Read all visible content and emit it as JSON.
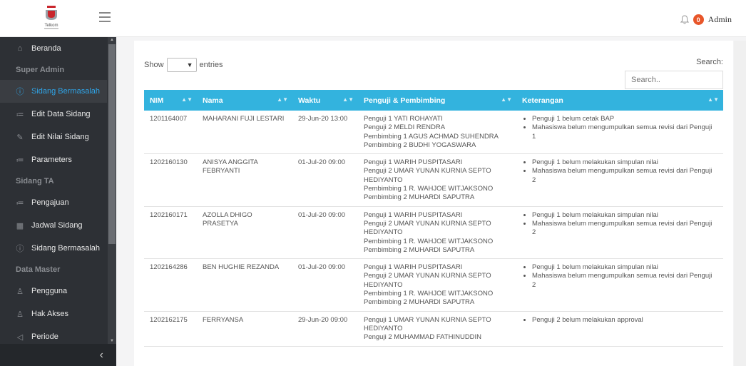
{
  "brand": {
    "logo_text": "Telkom"
  },
  "topbar": {
    "notif_count": "0",
    "user_name": "Admin",
    "bell_icon": "bell-icon"
  },
  "sidebar": {
    "items": [
      {
        "type": "item",
        "icon": "home-icon",
        "label": "Beranda"
      },
      {
        "type": "header",
        "label": "Super Admin"
      },
      {
        "type": "item",
        "icon": "alert-icon",
        "label": "Sidang Bermasalah",
        "active": true
      },
      {
        "type": "item",
        "icon": "list-icon",
        "label": "Edit Data Sidang"
      },
      {
        "type": "item",
        "icon": "pencil-icon",
        "label": "Edit Nilai Sidang"
      },
      {
        "type": "item",
        "icon": "list-icon",
        "label": "Parameters"
      },
      {
        "type": "header",
        "label": "Sidang TA"
      },
      {
        "type": "item",
        "icon": "list-icon",
        "label": "Pengajuan"
      },
      {
        "type": "item",
        "icon": "calendar-icon",
        "label": "Jadwal Sidang"
      },
      {
        "type": "item",
        "icon": "alert-icon",
        "label": "Sidang Bermasalah"
      },
      {
        "type": "header",
        "label": "Data Master"
      },
      {
        "type": "item",
        "icon": "user-icon",
        "label": "Pengguna"
      },
      {
        "type": "item",
        "icon": "user-icon",
        "label": "Hak Akses"
      },
      {
        "type": "item",
        "icon": "send-icon",
        "label": "Periode"
      }
    ],
    "collapse_glyph": "‹"
  },
  "table_controls": {
    "show_label": "Show",
    "entries_label": "entries",
    "search_label": "Search:",
    "search_placeholder": "Search.."
  },
  "table": {
    "columns": [
      "NIM",
      "Nama",
      "Waktu",
      "Penguji & Pembimbing",
      "Keterangan"
    ],
    "rows": [
      {
        "nim": "1201164007",
        "nama": "MAHARANI FUJI LESTARI",
        "waktu": "29-Jun-20 13:00",
        "penguji": [
          "Penguji 1 YATI ROHAYATI",
          "Penguji 2 MELDI RENDRA",
          "Pembimbing 1 AGUS ACHMAD SUHENDRA",
          "Pembimbing 2 BUDHI YOGASWARA"
        ],
        "keterangan": [
          "Penguji 1 belum cetak BAP",
          "Mahasiswa belum mengumpulkan semua revisi dari Penguji 1"
        ]
      },
      {
        "nim": "1202160130",
        "nama": "ANISYA ANGGITA FEBRYANTI",
        "waktu": "01-Jul-20 09:00",
        "penguji": [
          "Penguji 1 WARIH PUSPITASARI",
          "Penguji 2 UMAR YUNAN KURNIA SEPTO HEDIYANTO",
          "Pembimbing 1 R. WAHJOE WITJAKSONO",
          "Pembimbing 2 MUHARDI SAPUTRA"
        ],
        "keterangan": [
          "Penguji 1 belum melakukan simpulan nilai",
          "Mahasiswa belum mengumpulkan semua revisi dari Penguji 2"
        ]
      },
      {
        "nim": "1202160171",
        "nama": "AZOLLA DHIGO PRASETYA",
        "waktu": "01-Jul-20 09:00",
        "penguji": [
          "Penguji 1 WARIH PUSPITASARI",
          "Penguji 2 UMAR YUNAN KURNIA SEPTO HEDIYANTO",
          "Pembimbing 1 R. WAHJOE WITJAKSONO",
          "Pembimbing 2 MUHARDI SAPUTRA"
        ],
        "keterangan": [
          "Penguji 1 belum melakukan simpulan nilai",
          "Mahasiswa belum mengumpulkan semua revisi dari Penguji 2"
        ]
      },
      {
        "nim": "1202164286",
        "nama": "BEN HUGHIE REZANDA",
        "waktu": "01-Jul-20 09:00",
        "penguji": [
          "Penguji 1 WARIH PUSPITASARI",
          "Penguji 2 UMAR YUNAN KURNIA SEPTO HEDIYANTO",
          "Pembimbing 1 R. WAHJOE WITJAKSONO",
          "Pembimbing 2 MUHARDI SAPUTRA"
        ],
        "keterangan": [
          "Penguji 1 belum melakukan simpulan nilai",
          "Mahasiswa belum mengumpulkan semua revisi dari Penguji 2"
        ]
      },
      {
        "nim": "1202162175",
        "nama": "FERRYANSA",
        "waktu": "29-Jun-20 09:00",
        "penguji": [
          "Penguji 1 UMAR YUNAN KURNIA SEPTO HEDIYANTO",
          "Penguji 2 MUHAMMAD FATHINUDDIN"
        ],
        "keterangan": [
          "Penguji 2 belum melakukan approval"
        ]
      }
    ]
  },
  "colors": {
    "accent": "#33b3de",
    "sidebar_bg": "#2d3035",
    "active_text": "#2fa4e7",
    "badge": "#e8562a"
  }
}
